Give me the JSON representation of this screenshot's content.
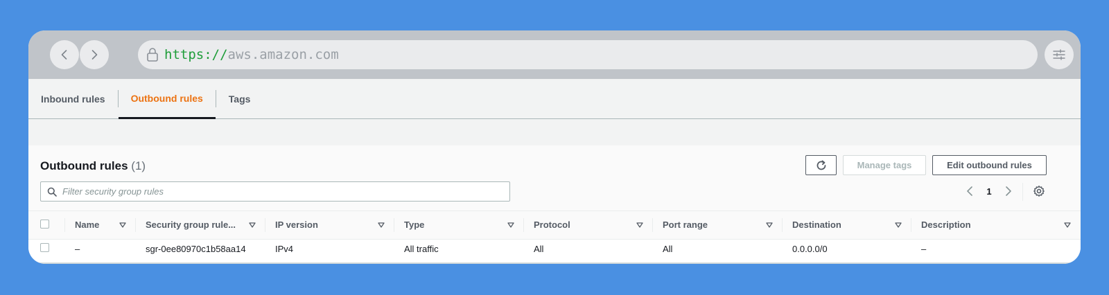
{
  "browser": {
    "url_scheme": "https://",
    "url_host": "aws.amazon.com"
  },
  "tabs": [
    {
      "label": "Inbound rules",
      "active": false
    },
    {
      "label": "Outbound rules",
      "active": true
    },
    {
      "label": "Tags",
      "active": false
    }
  ],
  "panel": {
    "title": "Outbound rules",
    "count": "(1)",
    "manage_tags_label": "Manage tags",
    "edit_label": "Edit outbound rules",
    "filter_placeholder": "Filter security group rules",
    "page_number": "1"
  },
  "table": {
    "columns": [
      "Name",
      "Security group rule...",
      "IP version",
      "Type",
      "Protocol",
      "Port range",
      "Destination",
      "Description"
    ],
    "rows": [
      [
        "–",
        "sgr-0ee80970c1b58aa14",
        "IPv4",
        "All traffic",
        "All",
        "All",
        "0.0.0.0/0",
        "–"
      ]
    ]
  },
  "colors": {
    "accent_orange": "#ec7211",
    "background_blue": "#4a90e2",
    "url_scheme_green": "#1f9d3a"
  },
  "icons": [
    "back-icon",
    "forward-icon",
    "lock-icon",
    "settings-sliders-icon",
    "refresh-icon",
    "search-icon",
    "chevron-left-icon",
    "chevron-right-icon",
    "gear-icon",
    "sort-down-icon"
  ]
}
